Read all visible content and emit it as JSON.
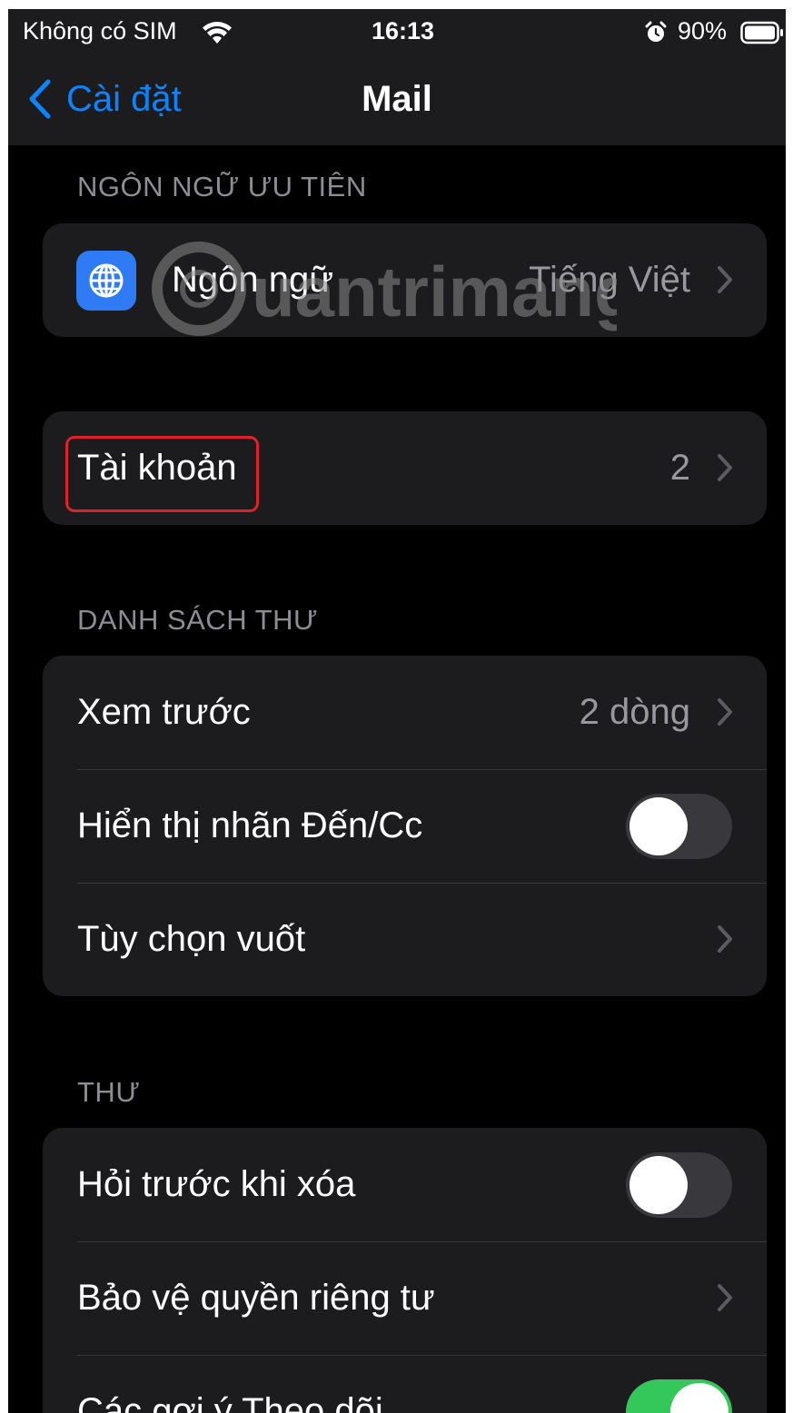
{
  "status_bar": {
    "carrier": "Không có SIM",
    "time": "16:13",
    "battery_percent": "90%",
    "icons": [
      "wifi-icon",
      "alarm-icon",
      "battery-icon"
    ]
  },
  "nav": {
    "back_label": "Cài đặt",
    "title": "Mail"
  },
  "sections": {
    "preferred_language": {
      "header": "NGÔN NGỮ ƯU TIÊN",
      "language": {
        "label": "Ngôn ngữ",
        "value": "Tiếng Việt",
        "icon": "globe-icon"
      }
    },
    "accounts": {
      "label": "Tài khoản",
      "value": "2",
      "highlighted": true
    },
    "message_list": {
      "header": "DANH SÁCH THƯ",
      "preview": {
        "label": "Xem trước",
        "value": "2 dòng"
      },
      "show_to_cc": {
        "label": "Hiển thị nhãn Đến/Cc",
        "on": false
      },
      "swipe_options": {
        "label": "Tùy chọn vuốt"
      }
    },
    "messages": {
      "header": "THƯ",
      "ask_before_deleting": {
        "label": "Hỏi trước khi xóa",
        "on": false
      },
      "privacy_protection": {
        "label": "Bảo vệ quyền riêng tư"
      },
      "follow_up_suggestions": {
        "label": "Các gợi ý Theo dõi",
        "on": true
      }
    }
  },
  "watermark_text": "Quantrimang",
  "colors": {
    "accent": "#0a84ff",
    "toggle_on": "#34c759",
    "highlight_box": "#e0202a",
    "background": "#000000",
    "cell": "#1c1c1e"
  }
}
